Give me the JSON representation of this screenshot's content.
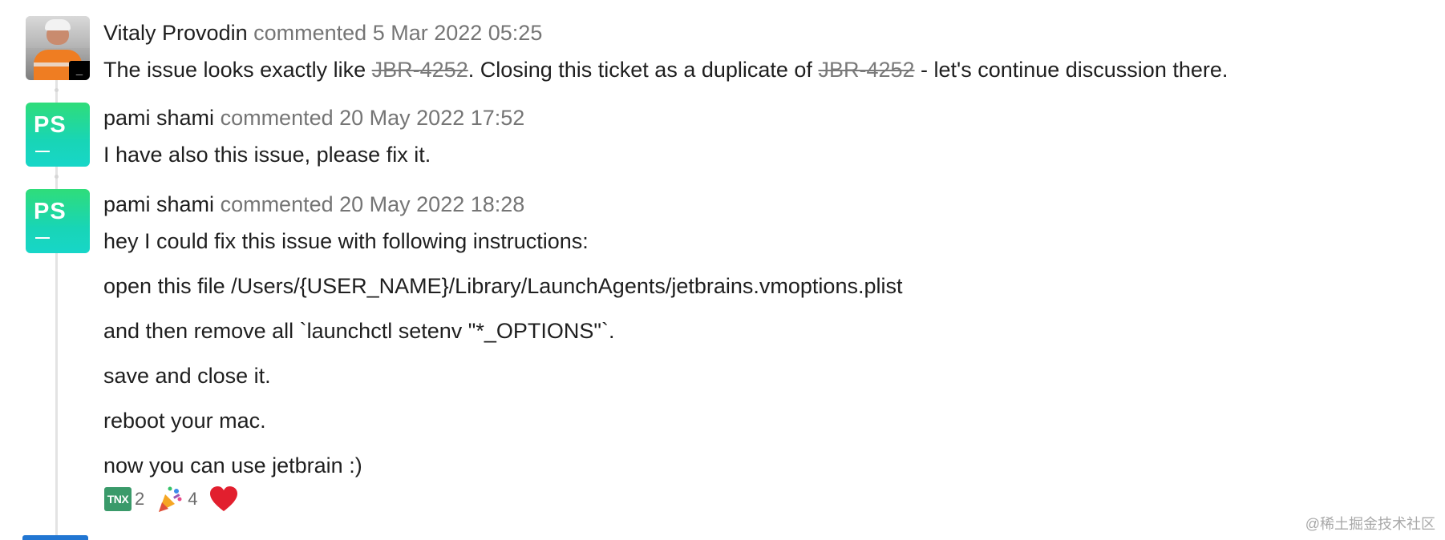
{
  "comments": [
    {
      "author": "Vitaly Provodin",
      "meta": "commented 5 Mar 2022 05:25",
      "avatar": {
        "kind": "photo",
        "badge": "_"
      },
      "body": {
        "part1": "The issue looks exactly like ",
        "link1": "JBR-4252",
        "part2": ". Closing this ticket as a duplicate of ",
        "link2": "JBR-4252",
        "part3": " - let's continue discussion there."
      }
    },
    {
      "author": "pami shami",
      "meta": "commented 20 May 2022 17:52",
      "avatar": {
        "kind": "initials",
        "initials": "PS"
      },
      "lines": [
        "I have also this issue, please fix it."
      ]
    },
    {
      "author": "pami shami",
      "meta": "commented 20 May 2022 18:28",
      "avatar": {
        "kind": "initials",
        "initials": "PS"
      },
      "lines": [
        "hey I could fix this issue with following instructions:",
        "open this file /Users/{USER_NAME}/Library/LaunchAgents/jetbrains.vmoptions.plist",
        "and then remove all `launchctl setenv \"*_OPTIONS\"`.",
        "save and close it.",
        "reboot your mac.",
        "now you can use jetbrain :)"
      ],
      "reactions": [
        {
          "emoji": "tnx-icon",
          "label": "TNX",
          "count": "2"
        },
        {
          "emoji": "party-popper-icon",
          "count": "4"
        },
        {
          "emoji": "red-heart-icon",
          "count": ""
        }
      ]
    }
  ],
  "watermark": "@稀土掘金技术社区",
  "colors": {
    "avatar_gradient_top": "#2fdd7a",
    "avatar_gradient_bottom": "#17d6c8",
    "meta_text": "#757575",
    "link_strike": "#7a7a7a"
  }
}
